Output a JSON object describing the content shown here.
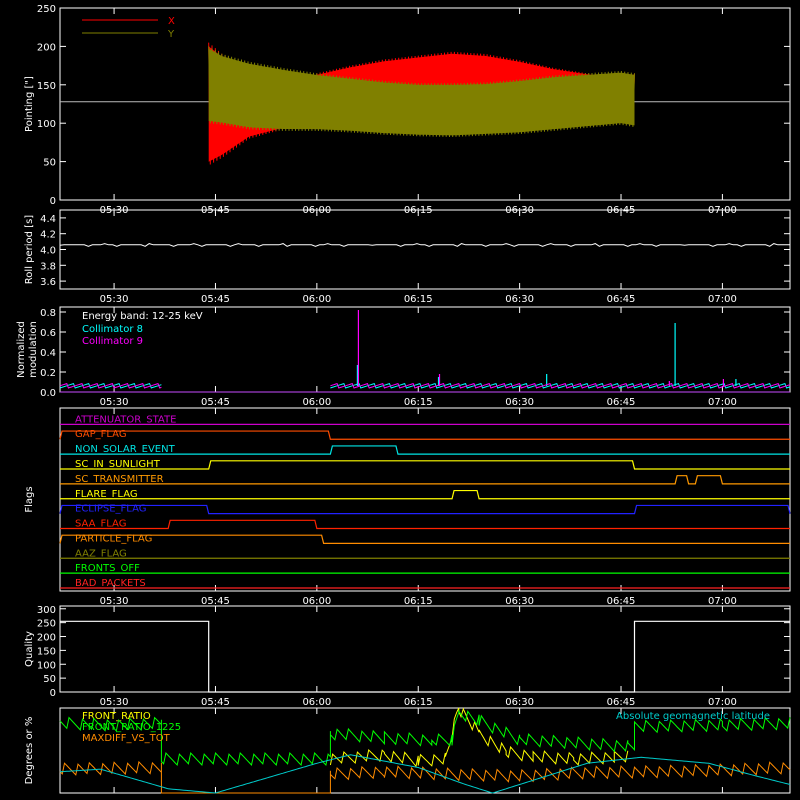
{
  "time_axis": {
    "start": "05:22",
    "end": "07:10",
    "tick_labels": [
      "05:30",
      "05:45",
      "06:00",
      "06:15",
      "06:30",
      "06:45",
      "07:00"
    ]
  },
  "chart_data": [
    {
      "type": "line",
      "id": "pointing",
      "ylabel": "Pointing [\"]",
      "ylim": [
        0,
        250
      ],
      "yticks": [
        0,
        50,
        100,
        150,
        200,
        250
      ],
      "legend_position": "top-left",
      "reference_line": 128,
      "series": [
        {
          "name": "X",
          "color": "#ff0000",
          "envelope": {
            "start": "05:44",
            "end": "06:47",
            "points": [
              [
                "05:44",
                45,
                205
              ],
              [
                "05:46",
                55,
                190
              ],
              [
                "05:50",
                80,
                170
              ],
              [
                "05:55",
                92,
                160
              ],
              [
                "06:00",
                100,
                165
              ],
              [
                "06:05",
                104,
                175
              ],
              [
                "06:10",
                106,
                183
              ],
              [
                "06:15",
                108,
                188
              ],
              [
                "06:20",
                108,
                193
              ],
              [
                "06:25",
                109,
                190
              ],
              [
                "06:30",
                112,
                182
              ],
              [
                "06:35",
                118,
                172
              ],
              [
                "06:40",
                122,
                165
              ],
              [
                "06:45",
                120,
                160
              ],
              [
                "06:47",
                118,
                165
              ]
            ]
          }
        },
        {
          "name": "Y",
          "color": "#808000",
          "envelope": {
            "start": "05:44",
            "end": "06:47",
            "points": [
              [
                "05:44",
                100,
                200
              ],
              [
                "05:46",
                98,
                190
              ],
              [
                "05:50",
                92,
                180
              ],
              [
                "05:55",
                90,
                172
              ],
              [
                "06:00",
                90,
                165
              ],
              [
                "06:05",
                88,
                160
              ],
              [
                "06:10",
                85,
                155
              ],
              [
                "06:15",
                83,
                152
              ],
              [
                "06:20",
                82,
                152
              ],
              [
                "06:25",
                84,
                153
              ],
              [
                "06:30",
                86,
                157
              ],
              [
                "06:35",
                90,
                162
              ],
              [
                "06:40",
                94,
                165
              ],
              [
                "06:45",
                98,
                168
              ],
              [
                "06:47",
                95,
                165
              ]
            ]
          }
        }
      ]
    },
    {
      "type": "line",
      "id": "roll",
      "ylabel": "Roll period [s]",
      "ylim": [
        3.5,
        4.5
      ],
      "yticks": [
        3.6,
        3.8,
        4.0,
        4.2,
        4.4
      ],
      "series": [
        {
          "name": "",
          "color": "#ffffff",
          "value": 4.06,
          "start": "05:22",
          "end": "07:10"
        }
      ]
    },
    {
      "type": "line",
      "id": "modulation",
      "ylabel": "Normalized modulation",
      "ylim": [
        0,
        0.85
      ],
      "yticks": [
        0.0,
        0.2,
        0.4,
        0.6,
        0.8
      ],
      "annotation": "Energy band: 12-25 keV",
      "series": [
        {
          "name": "Collimator 8",
          "color": "#00ffff",
          "base": 0.06,
          "segments": [
            [
              "05:22",
              "05:37"
            ],
            [
              "06:02",
              "07:10"
            ]
          ],
          "spikes": [
            [
              "06:06",
              0.27
            ],
            [
              "06:18",
              0.15
            ],
            [
              "06:34",
              0.18
            ],
            [
              "06:53",
              0.69
            ],
            [
              "07:02",
              0.13
            ]
          ]
        },
        {
          "name": "Collimator 9",
          "color": "#ff00ff",
          "base": 0.06,
          "segments": [
            [
              "05:22",
              "05:37"
            ],
            [
              "06:02",
              "07:10"
            ]
          ],
          "spikes": [
            [
              "06:06",
              0.82
            ],
            [
              "06:18",
              0.18
            ],
            [
              "06:52",
              0.11
            ],
            [
              "07:00",
              0.13
            ]
          ]
        }
      ]
    },
    {
      "type": "line",
      "id": "flags",
      "ylabel": "Flags",
      "series": [
        {
          "name": "ATTENUATOR_STATE",
          "color": "#cc00cc",
          "high": []
        },
        {
          "name": "GAP_FLAG",
          "color": "#ff4d00",
          "high": [
            [
              "05:22",
              "06:02"
            ]
          ]
        },
        {
          "name": "NON_SOLAR_EVENT",
          "color": "#00e5e5",
          "high": [
            [
              "06:02",
              "06:12"
            ]
          ]
        },
        {
          "name": "SC_IN_SUNLIGHT",
          "color": "#ffff00",
          "high": [
            [
              "05:44",
              "06:47"
            ]
          ]
        },
        {
          "name": "SC_TRANSMITTER",
          "color": "#ff9900",
          "high": [
            [
              "06:53",
              "06:55"
            ],
            [
              "06:56",
              "07:00"
            ]
          ]
        },
        {
          "name": "FLARE_FLAG",
          "color": "#ffff00",
          "high": [
            [
              "06:20",
              "06:24"
            ]
          ]
        },
        {
          "name": "ECLIPSE_FLAG",
          "color": "#2222ff",
          "high": [
            [
              "05:22",
              "05:44"
            ],
            [
              "06:47",
              "07:10"
            ]
          ]
        },
        {
          "name": "SAA_FLAG",
          "color": "#ff2200",
          "high": [
            [
              "05:38",
              "06:00"
            ]
          ]
        },
        {
          "name": "PARTICLE_FLAG",
          "color": "#ff8c00",
          "high": [
            [
              "05:22",
              "06:01"
            ]
          ]
        },
        {
          "name": "AAZ_FLAG",
          "color": "#808000",
          "high": []
        },
        {
          "name": "FRONTS_OFF",
          "color": "#00ff00",
          "high": []
        },
        {
          "name": "BAD_PACKETS",
          "color": "#ff2222",
          "high": []
        }
      ]
    },
    {
      "type": "line",
      "id": "quality",
      "ylabel": "Quality",
      "ylim": [
        0,
        310
      ],
      "yticks": [
        0,
        50,
        100,
        150,
        200,
        250,
        300
      ],
      "series": [
        {
          "name": "",
          "color": "#ffffff",
          "points": [
            [
              "05:22",
              255
            ],
            [
              "05:44",
              255
            ],
            [
              "05:44",
              0
            ],
            [
              "06:47",
              0
            ],
            [
              "06:47",
              255
            ],
            [
              "07:10",
              255
            ]
          ]
        }
      ]
    },
    {
      "type": "line",
      "id": "ratios",
      "ylabel": "Degrees or %",
      "ylim": [
        0,
        100
      ],
      "series": [
        {
          "name": "FRONT_RATIO",
          "color": "#ffff00",
          "points": [
            [
              "06:02",
              40
            ],
            [
              "06:10",
              45
            ],
            [
              "06:15",
              38
            ],
            [
              "06:19",
              40
            ],
            [
              "06:21",
              100
            ],
            [
              "06:24",
              70
            ],
            [
              "06:28",
              48
            ],
            [
              "06:32",
              43
            ],
            [
              "06:38",
              40
            ],
            [
              "06:44",
              42
            ],
            [
              "06:46",
              44
            ]
          ]
        },
        {
          "name": "FRONT_RATIO_1225",
          "color": "#00ff00",
          "points": [
            [
              "05:22",
              82
            ],
            [
              "05:30",
              80
            ],
            [
              "05:37",
              82
            ],
            [
              "05:37",
              40
            ],
            [
              "06:02",
              40
            ],
            [
              "06:02",
              70
            ],
            [
              "06:10",
              65
            ],
            [
              "06:17",
              62
            ],
            [
              "06:20",
              63
            ],
            [
              "06:21",
              95
            ],
            [
              "06:24",
              85
            ],
            [
              "06:30",
              63
            ],
            [
              "06:40",
              58
            ],
            [
              "06:46",
              55
            ],
            [
              "06:47",
              55
            ],
            [
              "06:47",
              78
            ],
            [
              "07:00",
              80
            ],
            [
              "07:10",
              82
            ]
          ]
        },
        {
          "name": "MAXDIFF_VS_TOT",
          "color": "#ff8c00",
          "points": [
            [
              "05:22",
              28
            ],
            [
              "05:37",
              30
            ],
            [
              "05:37",
              0
            ],
            [
              "06:02",
              0
            ],
            [
              "06:02",
              22
            ],
            [
              "06:10",
              25
            ],
            [
              "06:20",
              22
            ],
            [
              "06:30",
              20
            ],
            [
              "06:40",
              24
            ],
            [
              "06:50",
              25
            ],
            [
              "07:00",
              27
            ],
            [
              "07:10",
              30
            ]
          ]
        },
        {
          "name": "Absolute geomagnetic latitude",
          "color": "#00cccc",
          "points": [
            [
              "05:22",
              25
            ],
            [
              "05:28",
              28
            ],
            [
              "05:38",
              5
            ],
            [
              "05:45",
              0
            ],
            [
              "06:00",
              35
            ],
            [
              "06:05",
              45
            ],
            [
              "06:15",
              30
            ],
            [
              "06:22",
              10
            ],
            [
              "06:26",
              0
            ],
            [
              "06:32",
              15
            ],
            [
              "06:40",
              35
            ],
            [
              "06:48",
              42
            ],
            [
              "06:58",
              35
            ],
            [
              "07:05",
              20
            ],
            [
              "07:10",
              10
            ]
          ]
        }
      ]
    }
  ]
}
